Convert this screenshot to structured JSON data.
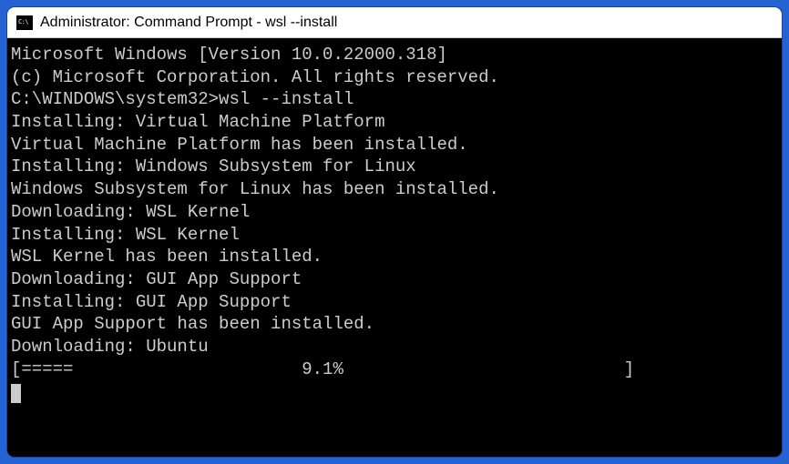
{
  "window": {
    "title": "Administrator: Command Prompt - wsl  --install",
    "icon_label": "CMD"
  },
  "terminal": {
    "header_line1": "Microsoft Windows [Version 10.0.22000.318]",
    "header_line2": "(c) Microsoft Corporation. All rights reserved.",
    "blank1": "",
    "prompt": "C:\\WINDOWS\\system32>",
    "command": "wsl --install",
    "lines": [
      "Installing: Virtual Machine Platform",
      "Virtual Machine Platform has been installed.",
      "Installing: Windows Subsystem for Linux",
      "Windows Subsystem for Linux has been installed.",
      "Downloading: WSL Kernel",
      "Installing: WSL Kernel",
      "WSL Kernel has been installed.",
      "Downloading: GUI App Support",
      "Installing: GUI App Support",
      "GUI App Support has been installed.",
      "Downloading: Ubuntu"
    ],
    "progress": {
      "bar": "[=====                      9.1%                           ]",
      "percent": 9.1
    }
  }
}
